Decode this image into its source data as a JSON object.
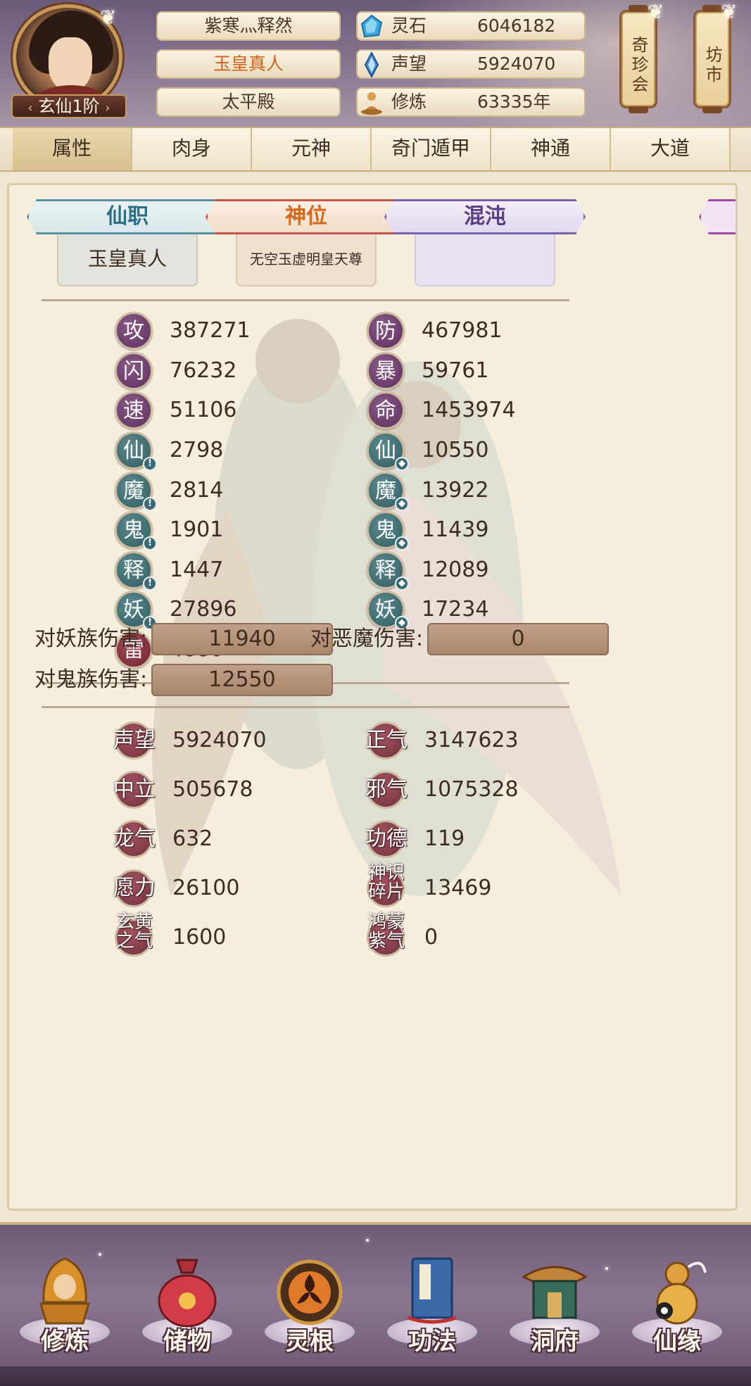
{
  "header": {
    "rank": "玄仙1阶",
    "name_plates": [
      "紫寒灬释然",
      "玉皇真人",
      "太平殿"
    ],
    "resources": [
      {
        "label": "灵石",
        "value": "6046182",
        "icon": "spirit-stone-icon"
      },
      {
        "label": "声望",
        "value": "5924070",
        "icon": "reputation-crystal-icon"
      },
      {
        "label": "修炼",
        "value": "63335年",
        "icon": "meditation-icon"
      }
    ],
    "lanterns": [
      "奇珍会",
      "坊市"
    ]
  },
  "tabs": [
    "属性",
    "肉身",
    "元神",
    "奇门遁甲",
    "神通",
    "大道"
  ],
  "cards": [
    {
      "title": "仙职",
      "value": "玉皇真人"
    },
    {
      "title": "神位",
      "value": "无空玉虚明皇天尊"
    },
    {
      "title": "混沌",
      "value": ""
    }
  ],
  "stats_left": [
    {
      "label": "攻",
      "value": "387271",
      "color": "#6b3a6a"
    },
    {
      "label": "闪",
      "value": "76232",
      "color": "#6b3a6a"
    },
    {
      "label": "速",
      "value": "51106",
      "color": "#6b3a6a"
    },
    {
      "label": "仙",
      "value": "2798",
      "color": "#3b6a6e"
    },
    {
      "label": "魔",
      "value": "2814",
      "color": "#3b6a6e"
    },
    {
      "label": "鬼",
      "value": "1901",
      "color": "#3b6a6e"
    },
    {
      "label": "释",
      "value": "1447",
      "color": "#3b6a6e"
    },
    {
      "label": "妖",
      "value": "27896",
      "color": "#3b6a6e"
    },
    {
      "label": "雷",
      "value": "4880",
      "color": "#8a3340"
    }
  ],
  "stats_right": [
    {
      "label": "防",
      "value": "467981"
    },
    {
      "label": "暴",
      "value": "59761"
    },
    {
      "label": "命",
      "value": "1453974"
    },
    {
      "label": "仙",
      "value": "10550"
    },
    {
      "label": "魔",
      "value": "13922"
    },
    {
      "label": "鬼",
      "value": "11439"
    },
    {
      "label": "释",
      "value": "12089"
    },
    {
      "label": "妖",
      "value": "17234"
    }
  ],
  "damage": [
    {
      "label": "对妖族伤害:",
      "value": "11940"
    },
    {
      "label": "对恶魔伤害:",
      "value": "0"
    },
    {
      "label": "对鬼族伤害:",
      "value": "12550"
    }
  ],
  "reputation_left": [
    {
      "label": "声望",
      "value": "5924070"
    },
    {
      "label": "中立",
      "value": "505678"
    },
    {
      "label": "龙气",
      "value": "632"
    },
    {
      "label": "愿力",
      "value": "26100"
    },
    {
      "label": "玄黄之气",
      "value": "1600"
    }
  ],
  "reputation_right": [
    {
      "label": "正气",
      "value": "3147623"
    },
    {
      "label": "邪气",
      "value": "1075328"
    },
    {
      "label": "功德",
      "value": "119"
    },
    {
      "label": "神识碎片",
      "value": "13469"
    },
    {
      "label": "鸿蒙紫气",
      "value": "0"
    }
  ],
  "bottom_nav": [
    "修炼",
    "储物",
    "灵根",
    "功法",
    "洞府",
    "仙缘"
  ]
}
